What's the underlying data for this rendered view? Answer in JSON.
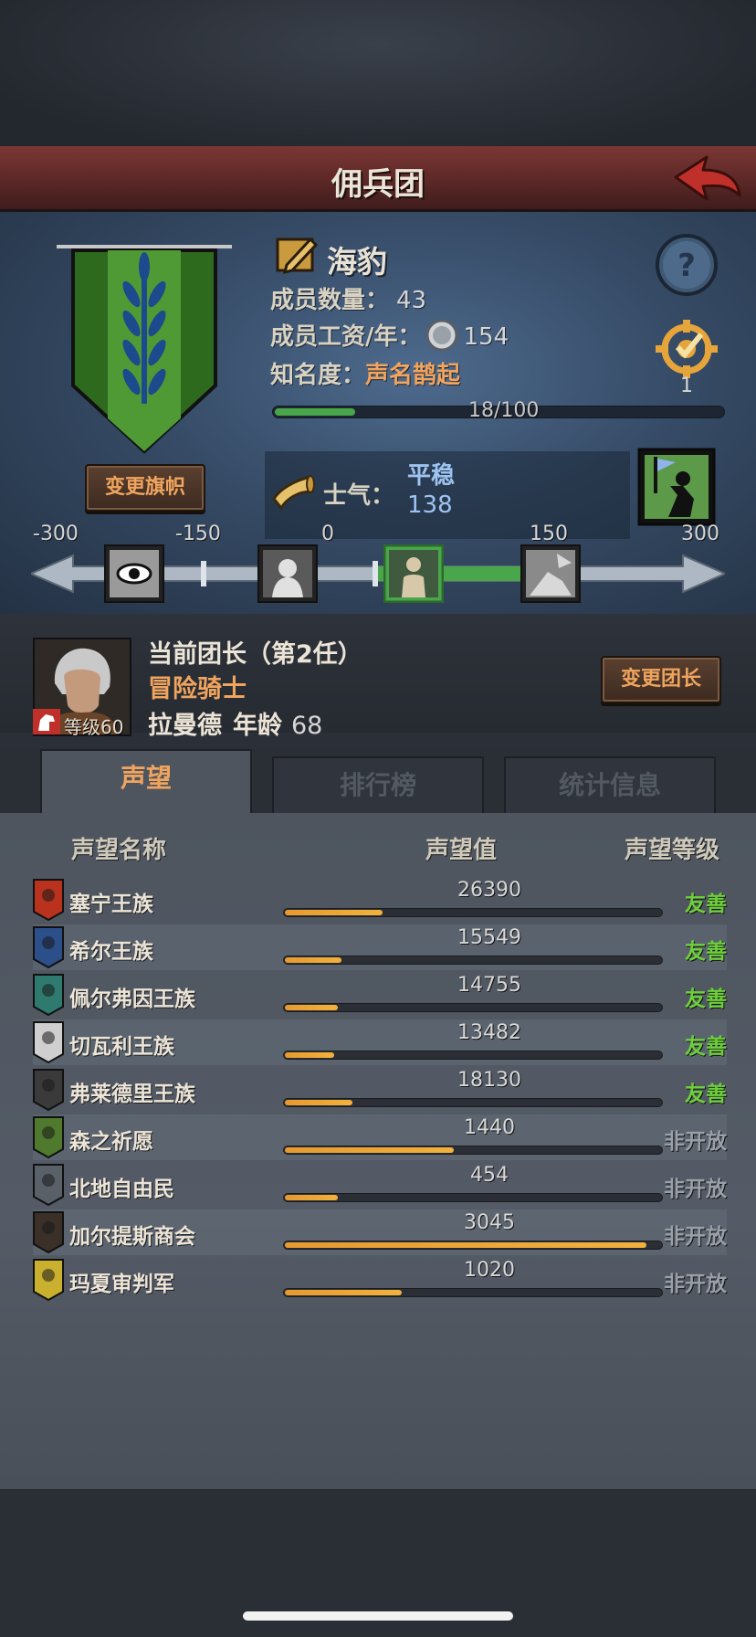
{
  "header": {
    "title": "佣兵团"
  },
  "guild": {
    "name": "海豹",
    "members_label": "成员数量：",
    "members_value": "43",
    "salary_label": "成员工资/年：",
    "salary_value": "154",
    "fame_label": "知名度：",
    "fame_value": "声名鹊起",
    "fame_progress_text": "18/100",
    "fame_progress": 0.18,
    "target_count": "1",
    "change_banner_label": "变更旗帜"
  },
  "morale": {
    "label": "士气：",
    "state": "平稳",
    "value": "138",
    "scale_ticks": [
      "-300",
      "-150",
      "0",
      "150",
      "300"
    ]
  },
  "leader": {
    "title": "当前团长（第2任）",
    "class": "冒险骑士",
    "name": "拉曼德",
    "age_label": "年龄",
    "age": "68",
    "level_text": "等级60",
    "change_leader_label": "变更团长"
  },
  "tabs": [
    {
      "label": "声望"
    },
    {
      "label": "排行榜"
    },
    {
      "label": "统计信息"
    }
  ],
  "list_header": {
    "name": "声望名称",
    "value": "声望值",
    "level": "声望等级"
  },
  "factions": [
    {
      "name": "塞宁王族",
      "value": "26390",
      "progress": 0.26,
      "level": "友善",
      "crest_color": "#b8321e"
    },
    {
      "name": "希尔王族",
      "value": "15549",
      "progress": 0.15,
      "level": "友善",
      "crest_color": "#2c4f8a"
    },
    {
      "name": "佩尔弗因王族",
      "value": "14755",
      "progress": 0.14,
      "level": "友善",
      "crest_color": "#2f7a6e"
    },
    {
      "name": "切瓦利王族",
      "value": "13482",
      "progress": 0.13,
      "level": "友善",
      "crest_color": "#cfcfcf"
    },
    {
      "name": "弗莱德里王族",
      "value": "18130",
      "progress": 0.18,
      "level": "友善",
      "crest_color": "#3a3a3a"
    },
    {
      "name": "森之祈愿",
      "value": "1440",
      "progress": 0.45,
      "level": "非开放",
      "crest_color": "#4f7a2e"
    },
    {
      "name": "北地自由民",
      "value": "454",
      "progress": 0.14,
      "level": "非开放",
      "crest_color": "#5a6068"
    },
    {
      "name": "加尔提斯商会",
      "value": "3045",
      "progress": 0.96,
      "level": "非开放",
      "crest_color": "#3a3028"
    },
    {
      "name": "玛夏审判军",
      "value": "1020",
      "progress": 0.31,
      "level": "非开放",
      "crest_color": "#c9b02e"
    }
  ],
  "colors": {
    "level_friendly": "#6ecf3c",
    "level_closed": "#9aa0a8",
    "accent": "#f0a45e"
  }
}
